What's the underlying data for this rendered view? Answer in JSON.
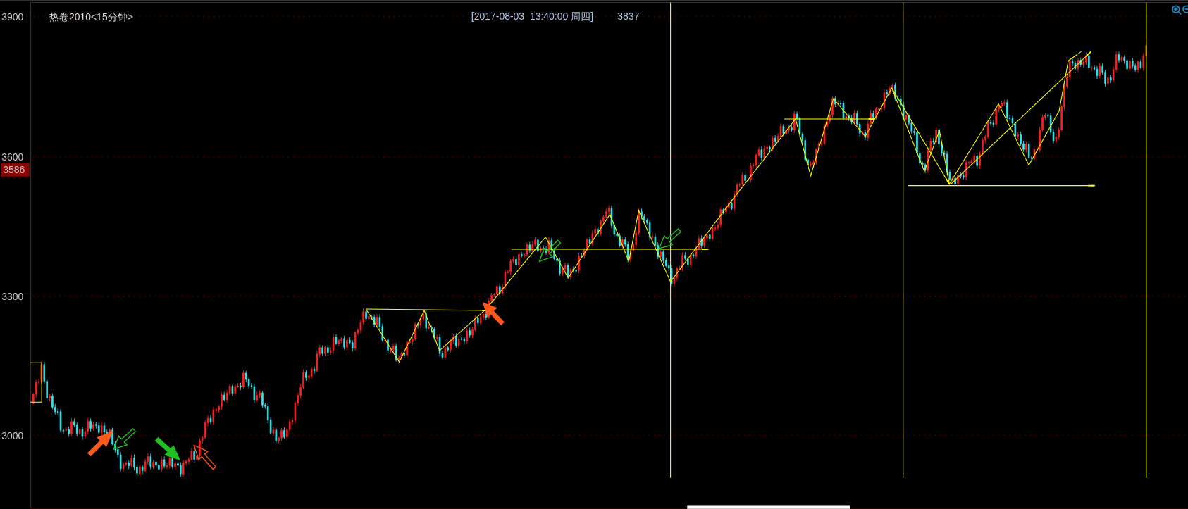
{
  "chart": {
    "title": "热卷2010<15分钟>",
    "cursor_info": {
      "datetime": "[2017-08-03  13:40:00 周四]",
      "price": "3837"
    },
    "y_axis_labels": [
      "3900",
      "3600",
      "3300",
      "3000"
    ],
    "current_price_marker": "3586"
  }
}
